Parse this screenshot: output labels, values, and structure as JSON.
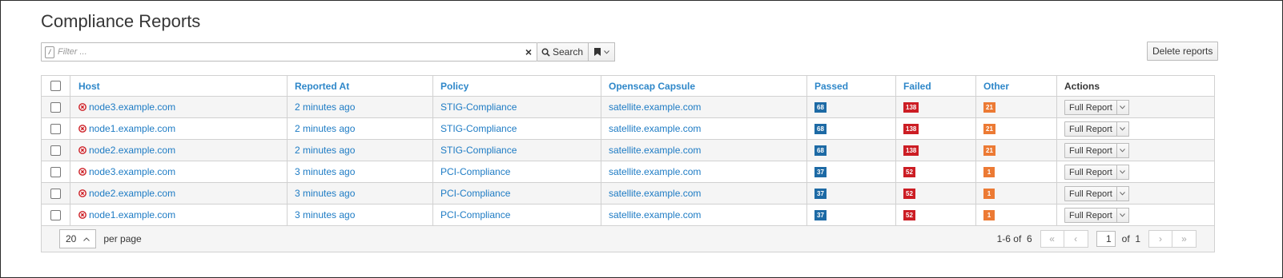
{
  "page": {
    "title": "Compliance Reports"
  },
  "filter": {
    "placeholder": "Filter ...",
    "slash_glyph": "/",
    "search_label": "Search"
  },
  "toolbar": {
    "delete_label": "Delete reports"
  },
  "table": {
    "columns": {
      "host": "Host",
      "reported_at": "Reported At",
      "policy": "Policy",
      "capsule": "Openscap Capsule",
      "passed": "Passed",
      "failed": "Failed",
      "other": "Other",
      "actions": "Actions"
    },
    "rows": [
      {
        "host": "node3.example.com",
        "reported_at": "2 minutes ago",
        "policy": "STIG-Compliance",
        "capsule": "satellite.example.com",
        "passed": "68",
        "failed": "138",
        "other": "21",
        "action": "Full Report"
      },
      {
        "host": "node1.example.com",
        "reported_at": "2 minutes ago",
        "policy": "STIG-Compliance",
        "capsule": "satellite.example.com",
        "passed": "68",
        "failed": "138",
        "other": "21",
        "action": "Full Report"
      },
      {
        "host": "node2.example.com",
        "reported_at": "2 minutes ago",
        "policy": "STIG-Compliance",
        "capsule": "satellite.example.com",
        "passed": "68",
        "failed": "138",
        "other": "21",
        "action": "Full Report"
      },
      {
        "host": "node3.example.com",
        "reported_at": "3 minutes ago",
        "policy": "PCI-Compliance",
        "capsule": "satellite.example.com",
        "passed": "37",
        "failed": "52",
        "other": "1",
        "action": "Full Report"
      },
      {
        "host": "node2.example.com",
        "reported_at": "3 minutes ago",
        "policy": "PCI-Compliance",
        "capsule": "satellite.example.com",
        "passed": "37",
        "failed": "52",
        "other": "1",
        "action": "Full Report"
      },
      {
        "host": "node1.example.com",
        "reported_at": "3 minutes ago",
        "policy": "PCI-Compliance",
        "capsule": "satellite.example.com",
        "passed": "37",
        "failed": "52",
        "other": "1",
        "action": "Full Report"
      }
    ]
  },
  "pagination": {
    "per_page": "20",
    "per_page_label": "per page",
    "range_text": "1-6 of  6",
    "current_page": "1",
    "of_text": "of  1"
  },
  "colors": {
    "link": "#1d7bc4",
    "passed_badge": "#1d6aa5",
    "failed_badge": "#cc1d24",
    "other_badge": "#ec7a34",
    "error_icon": "#cc1d24"
  },
  "icons": {
    "host_status": "error-circle-icon",
    "search": "search-icon",
    "bookmark": "bookmark-icon",
    "clear": "close-icon",
    "caret": "caret-down-icon"
  }
}
